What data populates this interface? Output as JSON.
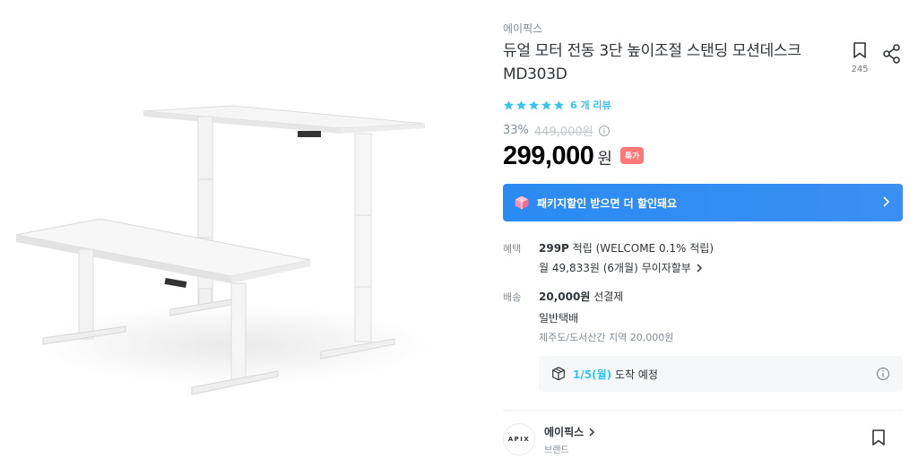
{
  "product": {
    "brand": "에이픽스",
    "title": "듀얼 모터 전동 3단 높이조절 스탠딩 모션데스크 MD303D",
    "bookmark_count": "245",
    "rating": {
      "stars": 5,
      "review_text": "6 개 리뷰"
    },
    "discount_rate": "33%",
    "original_price": "449,000원",
    "price": "299,000",
    "currency": "원",
    "special_badge": "특가"
  },
  "banner": {
    "text": "패키지할인 받으면 더 할인돼요"
  },
  "benefit": {
    "label": "혜택",
    "points": "299P",
    "points_desc": "적립 (WELCOME 0.1% 적립)",
    "installment": "월 49,833원 (6개월) 무이자할부"
  },
  "delivery": {
    "label": "배송",
    "fee": "20,000원",
    "fee_desc": "선결제",
    "type": "일반택배",
    "extra": "제주도/도서산간 지역 20,000원",
    "arrival_date": "1/5(월)",
    "arrival_desc": "도착 예정"
  },
  "brand_section": {
    "logo_text": "APIX",
    "name": "에이픽스",
    "subtitle": "브랜드"
  },
  "colors": {
    "accent": "#35c5f0",
    "banner": "#2a8bf2",
    "badge": "#ff7777"
  }
}
